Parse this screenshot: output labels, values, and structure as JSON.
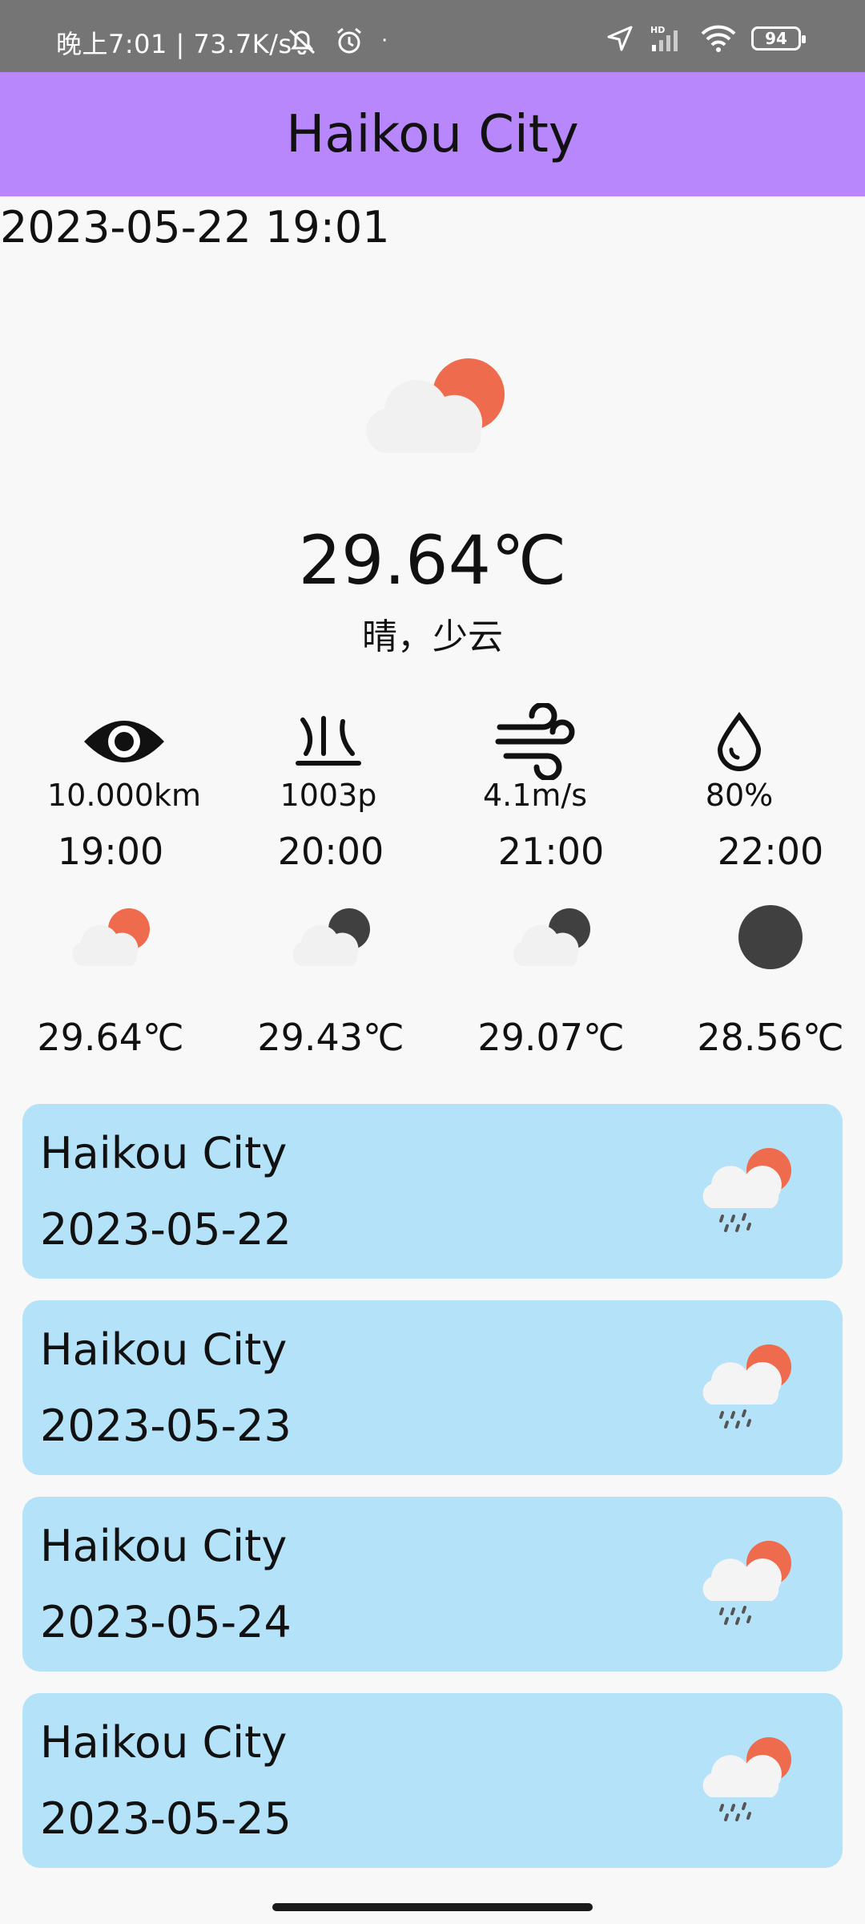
{
  "status": {
    "time_speed": "晚上7:01 | 73.7K/s",
    "battery": "94",
    "hd": "HD"
  },
  "header": {
    "title": "Haikou City"
  },
  "current": {
    "datetime": "2023-05-22 19:01",
    "temperature": "29.64℃",
    "description": "晴，少云"
  },
  "stats": [
    {
      "icon": "visibility-eye-icon",
      "value": "10.000km"
    },
    {
      "icon": "pressure-icon",
      "value": "1003p"
    },
    {
      "icon": "wind-icon",
      "value": "4.1m/s"
    },
    {
      "icon": "humidity-drop-icon",
      "value": "80%"
    }
  ],
  "hourly": [
    {
      "time": "19:00",
      "icon": "partly-cloudy-day-icon",
      "temp": "29.64℃"
    },
    {
      "time": "20:00",
      "icon": "partly-cloudy-night-icon",
      "temp": "29.43℃"
    },
    {
      "time": "21:00",
      "icon": "partly-cloudy-night-icon",
      "temp": "29.07℃"
    },
    {
      "time": "22:00",
      "icon": "clear-night-icon",
      "temp": "28.56℃"
    }
  ],
  "daily": [
    {
      "city": "Haikou City",
      "date": "2023-05-22",
      "icon": "rain-sun-icon"
    },
    {
      "city": "Haikou City",
      "date": "2023-05-23",
      "icon": "rain-sun-icon"
    },
    {
      "city": "Haikou City",
      "date": "2023-05-24",
      "icon": "rain-sun-icon"
    },
    {
      "city": "Haikou City",
      "date": "2023-05-25",
      "icon": "rain-sun-icon"
    }
  ],
  "colors": {
    "appbar": "#b887fb",
    "card": "#b4e2f9",
    "sun": "#ee6c4d",
    "moon": "#404040"
  }
}
